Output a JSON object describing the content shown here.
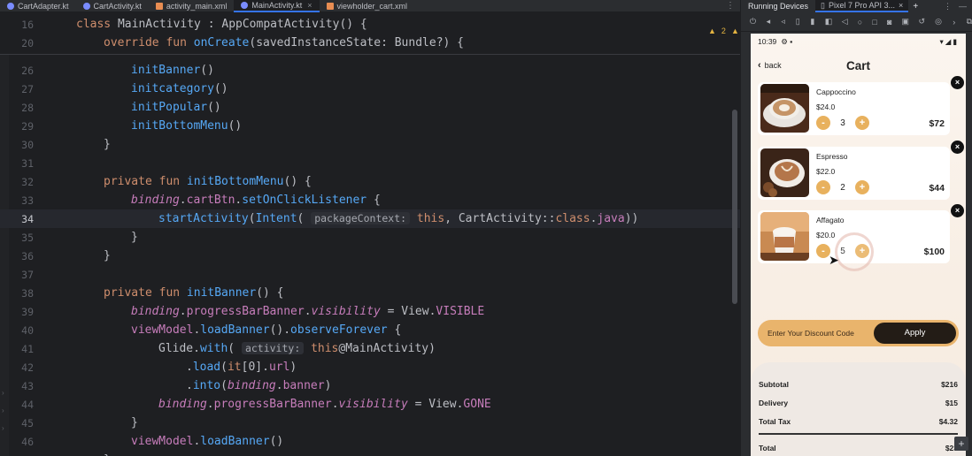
{
  "editor_tabs": [
    {
      "label": "CartAdapter.kt",
      "kind": "kotlin",
      "active": false
    },
    {
      "label": "CartActivity.kt",
      "kind": "kotlin",
      "active": false
    },
    {
      "label": "activity_main.xml",
      "kind": "xml",
      "active": false
    },
    {
      "label": "MainActivity.kt",
      "kind": "kotlin",
      "active": true
    },
    {
      "label": "viewholder_cart.xml",
      "kind": "xml",
      "active": false
    }
  ],
  "editor": {
    "inspection_counts": {
      "warnings": "2",
      "weak_warnings": "1"
    },
    "lines": [
      {
        "num": "16",
        "text": "class MainActivity : AppCompatActivity() {"
      },
      {
        "num": "20",
        "text": "override fun onCreate(savedInstanceState: Bundle?) {"
      },
      {
        "num": "26",
        "text": "initBanner()"
      },
      {
        "num": "27",
        "text": "initcategory()"
      },
      {
        "num": "28",
        "text": "initPopular()"
      },
      {
        "num": "29",
        "text": "initBottomMenu()"
      },
      {
        "num": "30",
        "text": "}"
      },
      {
        "num": "31",
        "text": ""
      },
      {
        "num": "32",
        "text": "private fun initBottomMenu() {"
      },
      {
        "num": "33",
        "text": "binding.cartBtn.setOnClickListener {"
      },
      {
        "num": "34",
        "text": "startActivity(Intent( packageContext: this, CartActivity::class.java))"
      },
      {
        "num": "35",
        "text": "}"
      },
      {
        "num": "36",
        "text": "}"
      },
      {
        "num": "37",
        "text": ""
      },
      {
        "num": "38",
        "text": "private fun initBanner() {"
      },
      {
        "num": "39",
        "text": "binding.progressBarBanner.visibility = View.VISIBLE"
      },
      {
        "num": "40",
        "text": "viewModel.loadBanner().observeForever {"
      },
      {
        "num": "41",
        "text": "Glide.with( activity: this@MainActivity)"
      },
      {
        "num": "42",
        "text": ".load(it[0].url)"
      },
      {
        "num": "43",
        "text": ".into(binding.banner)"
      },
      {
        "num": "44",
        "text": "binding.progressBarBanner.visibility = View.GONE"
      },
      {
        "num": "45",
        "text": "}"
      },
      {
        "num": "46",
        "text": "viewModel.loadBanner()"
      },
      {
        "num": "47",
        "text": "}"
      }
    ]
  },
  "devices": {
    "title": "Running Devices",
    "device_tab": "Pixel 7 Pro API 3..."
  },
  "phone": {
    "status_time": "10:39",
    "back_label": "back",
    "title": "Cart",
    "items": [
      {
        "name": "Cappoccino",
        "price": "$24.0",
        "qty": "3",
        "total": "$72"
      },
      {
        "name": "Espresso",
        "price": "$22.0",
        "qty": "2",
        "total": "$44"
      },
      {
        "name": "Affagato",
        "price": "$20.0",
        "qty": "5",
        "total": "$100"
      }
    ],
    "minus_label": "-",
    "plus_label": "+",
    "remove_label": "×",
    "discount_placeholder": "Enter Your Discount Code",
    "apply_label": "Apply",
    "summary": [
      {
        "label": "Subtotal",
        "value": "$216"
      },
      {
        "label": "Delivery",
        "value": "$15"
      },
      {
        "label": "Total Tax",
        "value": "$4.32"
      },
      {
        "label": "Total",
        "value": "$23"
      }
    ]
  },
  "colors": {
    "accent": "#3574f0",
    "qty_button": "#e8b15e",
    "apply_button": "#231c16",
    "discount_bar": "#e9b46c"
  }
}
